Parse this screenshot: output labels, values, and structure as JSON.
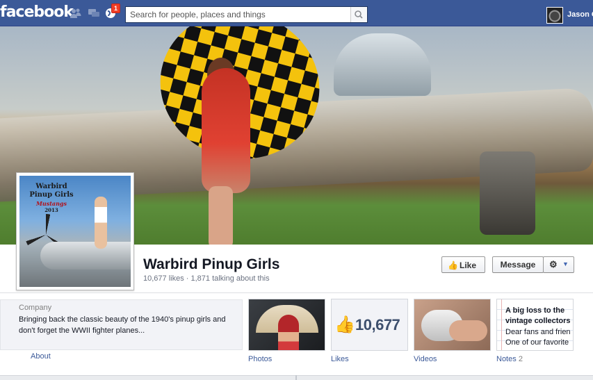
{
  "topbar": {
    "logo": "facebook",
    "notifications_count": "1",
    "search_placeholder": "Search for people, places and things",
    "username": "Jason C"
  },
  "cover": {
    "page_name": "Warbird Pinup Girls",
    "stats": "10,677 likes · 1,871 talking about this"
  },
  "profile_picture": {
    "logo_line1": "Warbird",
    "logo_line2": "Pinup Girls",
    "logo_line3": "Mustangs",
    "logo_line4": "2013"
  },
  "actions": {
    "like_label": "Like",
    "message_label": "Message"
  },
  "about": {
    "category": "Company",
    "description": "Bringing back the classic beauty of the 1940's pinup girls and don't forget the WWII fighter planes...",
    "link_label": "About"
  },
  "tiles": {
    "photos_label": "Photos",
    "likes_label": "Likes",
    "likes_count": "10,677",
    "videos_label": "Videos",
    "notes_label": "Notes",
    "notes_count": "2",
    "note_title_1": "A big loss to the",
    "note_title_2": "vintage collectors",
    "note_body_1": "Dear fans and frien",
    "note_body_2": "One of our favorite"
  },
  "colors": {
    "brand": "#3b5998",
    "link": "#3b5998",
    "badge": "#f03d25"
  }
}
